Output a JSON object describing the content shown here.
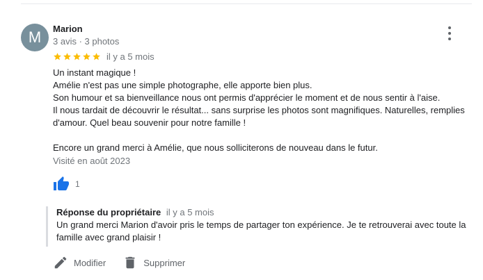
{
  "review": {
    "author": {
      "initial": "M",
      "name": "Marion",
      "meta": "3 avis · 3 photos",
      "avatar_color": "#78909c"
    },
    "rating": 5,
    "star_color": "#fbbc04",
    "relative_date": "il y a 5 mois",
    "text_lines": [
      "Un instant magique !",
      "Amélie n'est pas une simple photographe, elle apporte bien plus.",
      "Son humour et sa bienveillance nous ont permis d'apprécier le moment et de nous sentir à l'aise.",
      "Il nous tardait de découvrir le résultat... sans surprise les photos sont magnifiques. Naturelles, remplies d'amour. Quel beau souvenir pour notre famille !",
      "Encore un grand merci à Amélie, que nous solliciterons de nouveau dans le futur."
    ],
    "visit_date": "Visité en août 2023",
    "likes": {
      "count": "1",
      "icon": "thumbs-up-icon",
      "color": "#1a73e8"
    }
  },
  "owner_reply": {
    "title": "Réponse du propriétaire",
    "relative_date": "il y a 5 mois",
    "text": "Un grand merci Marion d'avoir pris le temps de partager ton expérience. Je te retrouverai avec toute la famille avec grand plaisir !"
  },
  "actions": {
    "edit_label": "Modifier",
    "edit_icon": "pencil-icon",
    "delete_label": "Supprimer",
    "delete_icon": "trash-icon"
  },
  "menu_icon": "more-vert-icon"
}
